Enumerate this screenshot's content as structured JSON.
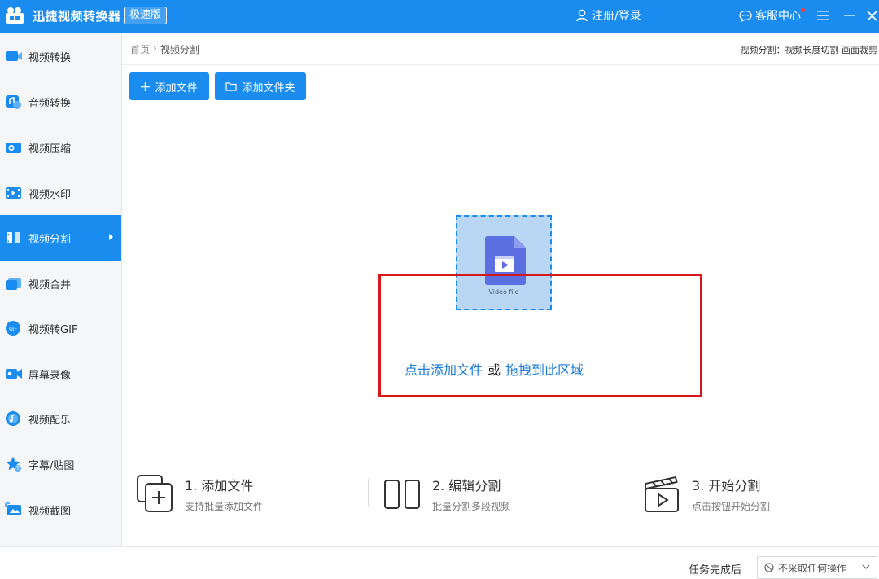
{
  "app": {
    "title": "迅捷视频转换器",
    "edition": "极速版",
    "login_label": "注册/登录",
    "service_label": "客服中心"
  },
  "colors": {
    "accent": "#1a8cf0",
    "highlight": "#d9161b",
    "link": "#1a7ad6"
  },
  "sidebar": {
    "items": [
      {
        "label": "视频转换",
        "icon": "video-convert-icon"
      },
      {
        "label": "音频转换",
        "icon": "audio-convert-icon"
      },
      {
        "label": "视频压缩",
        "icon": "video-compress-icon"
      },
      {
        "label": "视频水印",
        "icon": "video-watermark-icon"
      },
      {
        "label": "视频分割",
        "icon": "video-split-icon",
        "active": true
      },
      {
        "label": "视频合并",
        "icon": "video-merge-icon"
      },
      {
        "label": "视频转GIF",
        "icon": "gif-icon"
      },
      {
        "label": "屏幕录像",
        "icon": "screen-record-icon"
      },
      {
        "label": "视频配乐",
        "icon": "music-icon"
      },
      {
        "label": "字幕/贴图",
        "icon": "subtitle-sticker-icon"
      },
      {
        "label": "视频截图",
        "icon": "screenshot-icon"
      }
    ]
  },
  "breadcrumb": {
    "home": "首页",
    "separator": "›",
    "current": "视频分割"
  },
  "header_info": "视频分割：视频长度切割 画面裁剪",
  "toolbar": {
    "add_file": "添加文件",
    "add_folder": "添加文件夹"
  },
  "dropzone": {
    "file_caption": "Video file",
    "click_add": "点击添加文件",
    "or": "或",
    "drag_here": "拖拽到此区域"
  },
  "steps": [
    {
      "title": "1. 添加文件",
      "desc": "支持批量添加文件"
    },
    {
      "title": "2. 编辑分割",
      "desc": "批量分割多段视频"
    },
    {
      "title": "3. 开始分割",
      "desc": "点击按钮开始分割"
    }
  ],
  "status": {
    "after_label": "任务完成后",
    "after_value": "不采取任何操作"
  }
}
